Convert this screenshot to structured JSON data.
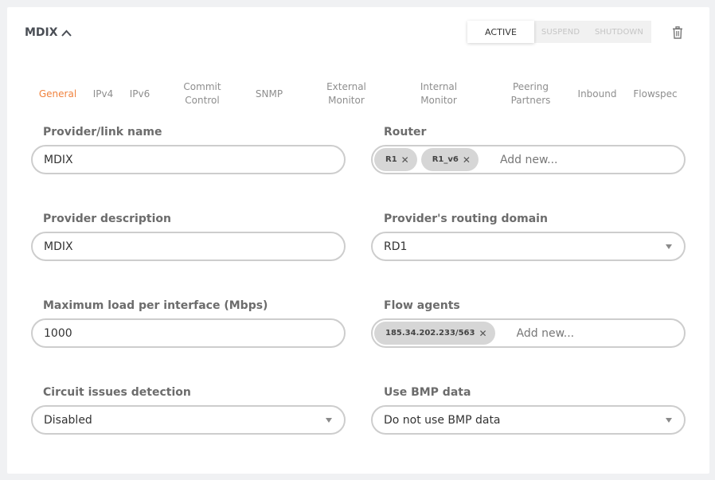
{
  "provider": {
    "title": "MDIX",
    "collapse_icon": "chevron-up-icon"
  },
  "state": {
    "options": [
      "ACTIVE",
      "SUSPEND",
      "SHUTDOWN"
    ],
    "selected": "ACTIVE"
  },
  "delete_icon": "trash-icon",
  "tabs": [
    {
      "label": "General",
      "active": true
    },
    {
      "label": "IPv4"
    },
    {
      "label": "IPv6"
    },
    {
      "label": "Commit\nControl"
    },
    {
      "label": "SNMP"
    },
    {
      "label": "External\nMonitor"
    },
    {
      "label": "Internal\nMonitor"
    },
    {
      "label": "Peering\nPartners"
    },
    {
      "label": "Inbound"
    },
    {
      "label": "Flowspec"
    }
  ],
  "form": {
    "provider_name": {
      "label": "Provider/link name",
      "value": "MDIX"
    },
    "router": {
      "label": "Router",
      "chips": [
        "R1",
        "R1_v6"
      ],
      "placeholder": "Add new..."
    },
    "provider_description": {
      "label": "Provider description",
      "value": "MDIX"
    },
    "routing_domain": {
      "label": "Provider's routing domain",
      "value": "RD1"
    },
    "max_load": {
      "label": "Maximum load per interface (Mbps)",
      "value": "1000"
    },
    "flow_agents": {
      "label": "Flow agents",
      "chips": [
        "185.34.202.233/563"
      ],
      "placeholder": "Add new..."
    },
    "circuit_detection": {
      "label": "Circuit issues detection",
      "value": "Disabled"
    },
    "bmp_data": {
      "label": "Use BMP data",
      "value": "Do not use BMP data"
    }
  },
  "colors": {
    "accent": "#f0833f",
    "tab_inactive": "#8e8e8e",
    "label": "#6c6c6c",
    "border": "#cdcdcd",
    "chip_bg": "#d6d6d6"
  }
}
